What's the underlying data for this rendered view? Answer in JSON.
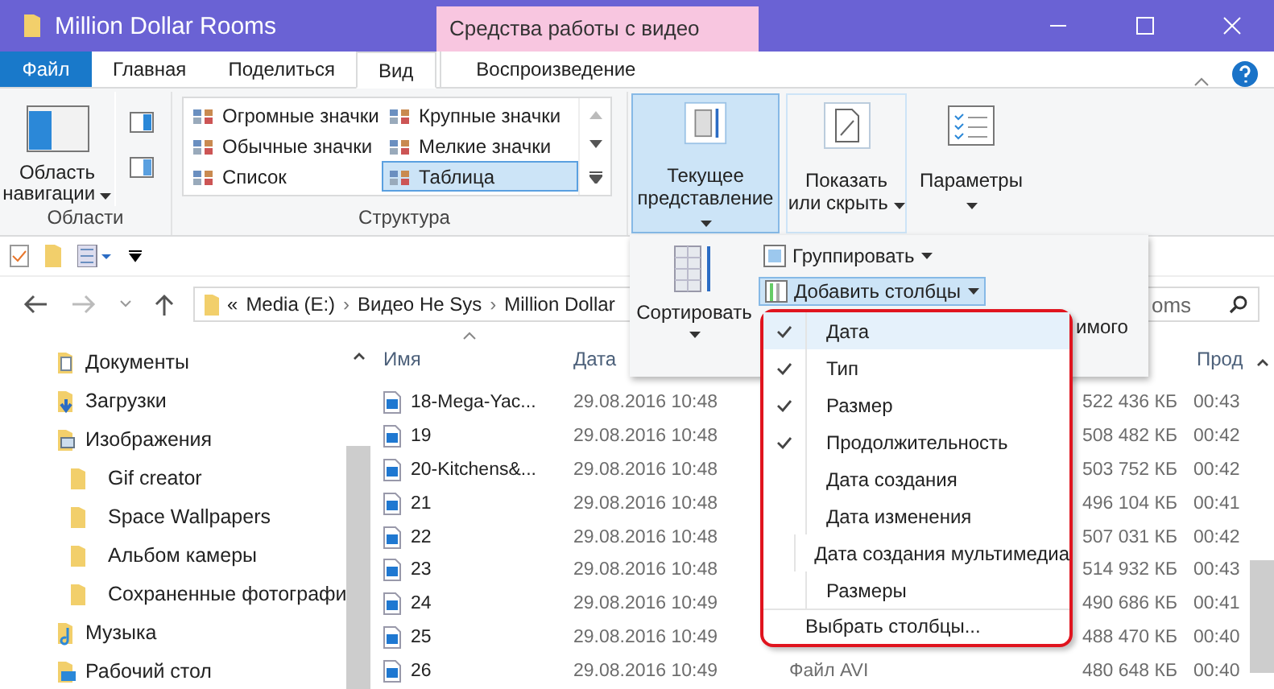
{
  "window": {
    "title": "Million Dollar Rooms",
    "context_tab_header": "Средства работы с видео"
  },
  "tabs": [
    {
      "label": "Файл",
      "kind": "file",
      "selected": false
    },
    {
      "label": "Главная",
      "kind": "tab",
      "selected": false
    },
    {
      "label": "Поделиться",
      "kind": "tab",
      "selected": false
    },
    {
      "label": "Вид",
      "kind": "tab",
      "selected": true
    },
    {
      "label": "Воспроизведение",
      "kind": "context",
      "selected": false
    }
  ],
  "ribbon": {
    "panes": {
      "nav_button": "Область навигации",
      "group_label": "Области"
    },
    "layout": {
      "items": [
        {
          "label": "Огромные значки",
          "selected": false
        },
        {
          "label": "Крупные значки",
          "selected": false
        },
        {
          "label": "Обычные значки",
          "selected": false
        },
        {
          "label": "Мелкие значки",
          "selected": false
        },
        {
          "label": "Список",
          "selected": false
        },
        {
          "label": "Таблица",
          "selected": true
        }
      ],
      "group_label": "Структура"
    },
    "big_buttons": [
      {
        "label": "Текущее представление",
        "kind": "view",
        "pressed": true
      },
      {
        "label": "Показать или скрыть",
        "kind": "showhide",
        "pressed": false
      },
      {
        "label": "Параметры",
        "kind": "options",
        "pressed": false
      }
    ]
  },
  "address": {
    "segments": [
      "«",
      "Media (E:)",
      "›",
      "Видео Не Sys",
      "›",
      "Million Dollar"
    ]
  },
  "search": {
    "placeholder": "oms"
  },
  "view_panel": {
    "sort_button": "Сортировать",
    "group_button": "Группировать",
    "add_columns_button": "Добавить столбцы",
    "partial_label": "имого"
  },
  "columns_menu": {
    "items": [
      {
        "label": "Дата",
        "checked": true,
        "highlighted": true
      },
      {
        "label": "Тип",
        "checked": true,
        "highlighted": false
      },
      {
        "label": "Размер",
        "checked": true,
        "highlighted": false
      },
      {
        "label": "Продолжительность",
        "checked": true,
        "highlighted": false
      },
      {
        "label": "Дата создания",
        "checked": false,
        "highlighted": false
      },
      {
        "label": "Дата изменения",
        "checked": false,
        "highlighted": false
      },
      {
        "label": "Дата создания мультимедиа",
        "checked": false,
        "highlighted": false
      },
      {
        "label": "Размеры",
        "checked": false,
        "highlighted": false
      }
    ],
    "footer": "Выбрать столбцы..."
  },
  "sidebar": {
    "items": [
      {
        "label": "Документы",
        "kind": "docs",
        "nested": false
      },
      {
        "label": "Загрузки",
        "kind": "downloads",
        "nested": false
      },
      {
        "label": "Изображения",
        "kind": "pictures",
        "nested": false
      },
      {
        "label": "Gif creator",
        "kind": "folder",
        "nested": true
      },
      {
        "label": "Space Wallpapers",
        "kind": "folder",
        "nested": true
      },
      {
        "label": "Альбом камеры",
        "kind": "folder",
        "nested": true
      },
      {
        "label": "Сохраненные фотографи",
        "kind": "folder",
        "nested": true
      },
      {
        "label": "Музыка",
        "kind": "music",
        "nested": false
      },
      {
        "label": "Рабочий стол",
        "kind": "desktop",
        "nested": false
      }
    ]
  },
  "table": {
    "columns": [
      "Имя",
      "Дата",
      "Прод"
    ],
    "rows": [
      {
        "name": "18-Mega-Yac...",
        "date": "29.08.2016 10:48",
        "size": "522 436 КБ",
        "duration": "00:43"
      },
      {
        "name": "19",
        "date": "29.08.2016 10:48",
        "size": "508 482 КБ",
        "duration": "00:42"
      },
      {
        "name": "20-Kitchens&...",
        "date": "29.08.2016 10:48",
        "size": "503 752 КБ",
        "duration": "00:42"
      },
      {
        "name": "21",
        "date": "29.08.2016 10:48",
        "size": "496 104 КБ",
        "duration": "00:41"
      },
      {
        "name": "22",
        "date": "29.08.2016 10:48",
        "size": "507 031 КБ",
        "duration": "00:42"
      },
      {
        "name": "23",
        "date": "29.08.2016 10:48",
        "size": "514 932 КБ",
        "duration": "00:43"
      },
      {
        "name": "24",
        "date": "29.08.2016 10:49",
        "size": "490 686 КБ",
        "duration": "00:41"
      },
      {
        "name": "25",
        "date": "29.08.2016 10:49",
        "size": "488 470 КБ",
        "duration": "00:40"
      },
      {
        "name": "26",
        "date": "29.08.2016 10:49",
        "type": "Файл  AVI",
        "size": "480 648 КБ",
        "duration": "00:40"
      }
    ]
  }
}
